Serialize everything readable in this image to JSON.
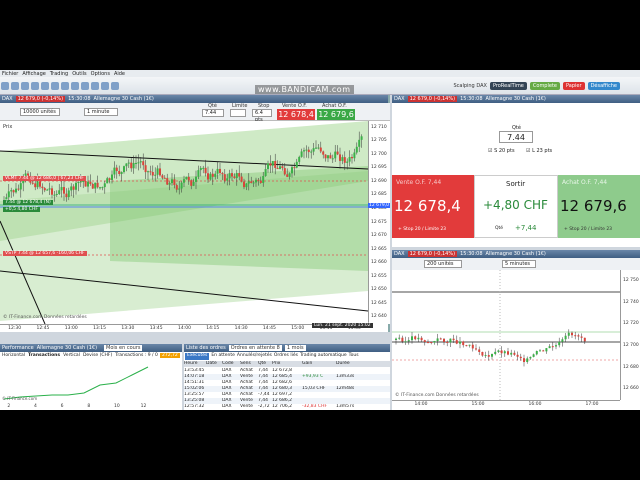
{
  "menu": [
    "Fichier",
    "Affichage",
    "Trading",
    "Outils",
    "Options",
    "Aide"
  ],
  "watermark": "www.BANDICAM.com",
  "topright": {
    "scalping": "Scalping DAX",
    "brand": "ProRealTime",
    "badge": "Complete",
    "papier": "Papier",
    "desaffiche": "Désaffiche"
  },
  "left": {
    "header": {
      "symbol": "DAX",
      "price": "12 679,0 (-0,14%)",
      "time": "15:30:08",
      "name": "Allemagne 30 Cash (1€)"
    },
    "bars_select": "10000 unités",
    "tf_select": "1 minute",
    "qty_label": "Qté",
    "qty": "7.44",
    "limit_label": "Limite",
    "stop_label": "Stop",
    "stop_val": "6.4 pts",
    "sell_label": "Vente O.F.",
    "sell_price": "12 678,4",
    "buy_label": "Achat O.F.",
    "buy_price": "12 679,6",
    "price_tag": "Prix",
    "vlimit": "VLMT 7.44 @ 12 686,0 | 67,23 CHF",
    "pos": "7.44 @ 12 678,4 (N)",
    "pnl": "+0,5  4,80 CHF",
    "vstop": "VSTP 7.44 @ 12 657,6  -160,06 CHF",
    "yticks": [
      "12 710",
      "12 705",
      "12 700",
      "12 695",
      "12 690",
      "12 685",
      "12 680",
      "12 675",
      "12 670",
      "12 665",
      "12 660",
      "12 655",
      "12 650",
      "12 645",
      "12 640"
    ],
    "xticks": [
      "12:30",
      "12:45",
      "13:00",
      "13:15",
      "13:30",
      "13:45",
      "14:00",
      "14:15",
      "14:30",
      "14:45",
      "15:00",
      "15:15",
      "15:30"
    ],
    "lastprice": "12 679,0",
    "date_tag": "Lun. 21 sept. 2020 15:02",
    "footer": "© IT-Finance.com  Données retardées"
  },
  "orderpanel": {
    "header": {
      "symbol": "DAX",
      "price": "12 679,0 (-0,14%)",
      "time": "15:30:08",
      "name": "Allemagne 30 Cash (1€)"
    },
    "qty_label": "Qté",
    "qty": "7.44",
    "s_label": "S",
    "s_val": "20 pts",
    "l_label": "L",
    "l_val": "23 pts",
    "sell_label": "Vente O.F. 7,44",
    "sell_price": "12 678,4",
    "sell_note": "+ Stop 20 / Limite 23",
    "exit_label": "Sortir",
    "exit_value": "+4,80 CHF",
    "qty_small": "Qté",
    "qty_small_val": "+7,44",
    "buy_label": "Achat O.F. 7,44",
    "buy_price": "12 679,6",
    "buy_note": "+ Stop 20 / Limite 23"
  },
  "rightchart": {
    "header": {
      "symbol": "DAX",
      "price": "12 679,0 (-0,14%)",
      "time": "15:30:08",
      "name": "Allemagne 30 Cash (1€)"
    },
    "bars_select": "200 unités",
    "tf_select": "5 minutes",
    "yticks": [
      "12 750",
      "12 740",
      "12 720",
      "12 700",
      "12 680",
      "12 660"
    ],
    "xticks": [
      "14:00",
      "15:00",
      "16:00",
      "17:00"
    ],
    "footer": "© IT-Finance.com  Données retardées"
  },
  "perf": {
    "title": "Performance",
    "symbol": "Allemagne 30 Cash (1€)",
    "period": "Mois en cours",
    "tabs": [
      "Horizontal",
      "Transactions",
      "Vertical",
      "Devise (CHF)",
      "Transactions : 9 / 0"
    ],
    "value": "272,72",
    "xticks": [
      "2",
      "4",
      "6",
      "8",
      "10",
      "12"
    ],
    "footer": "© IT-Finance.com"
  },
  "orders": {
    "title": "Liste des ordres",
    "filter": "Ordres en attente 8",
    "period": "1 mois",
    "tabs": [
      "Exécutés",
      "En attente",
      "Annulés/rejetés",
      "Ordres liés",
      "Trading automatique",
      "Tous"
    ],
    "columns": [
      "Heure",
      "Date",
      "Code",
      "Sens",
      "Qté",
      "Prix",
      "Gain",
      "Durée"
    ],
    "rows": [
      [
        "13:53:45",
        "",
        "DAX",
        "Achat",
        "7,44",
        "12 672,8",
        "",
        ""
      ],
      [
        "14:07:18",
        "",
        "DAX",
        "Vente",
        "7,44",
        "12 685,4",
        "+93,93 C",
        "13m33s"
      ],
      [
        "14:51:31",
        "",
        "DAX",
        "Achat",
        "7,44",
        "12 682,6",
        "",
        ""
      ],
      [
        "15:02:06",
        "",
        "DAX",
        "Achat",
        "7,44",
        "12 680,3",
        "15,03 CHF",
        "12m48s"
      ],
      [
        "13:25:57",
        "",
        "DAX",
        "Achat",
        "-7,44",
        "12 697,2",
        "",
        ""
      ],
      [
        "13:25:08",
        "",
        "DAX",
        "Vente",
        "7,44",
        "12 686,2",
        "",
        ""
      ],
      [
        "12:57:32",
        "",
        "DAX",
        "Vente",
        "-2,72",
        "12 706,2",
        "-32,83 CHF",
        "13m57s"
      ]
    ]
  },
  "colors": {
    "sell": "#e23b3b",
    "buy": "#3aa845",
    "panelhead": "#4a6a90",
    "channel": "#9fd08f"
  }
}
